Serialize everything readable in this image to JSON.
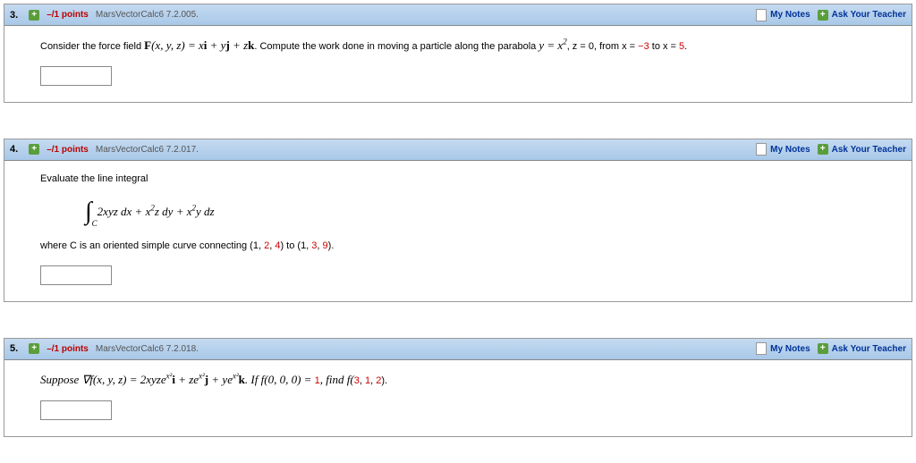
{
  "labels": {
    "my_notes": "My Notes",
    "ask_teacher": "Ask Your Teacher"
  },
  "questions": [
    {
      "number": "3.",
      "points": "–/1 points",
      "source": "MarsVectorCalc6 7.2.005.",
      "text_prefix": "Consider the force field ",
      "formula1": "F(x, y, z) = xi + yj + zk",
      "text_mid": ". Compute the work done in moving a particle along the parabola ",
      "formula2": "y = x²",
      "text_mid2": ", z = 0, from x = ",
      "val1": "−3",
      "text_mid3": " to x = ",
      "val2": "5",
      "text_end": "."
    },
    {
      "number": "4.",
      "points": "–/1 points",
      "source": "MarsVectorCalc6 7.2.017.",
      "line1": "Evaluate the line integral",
      "integral_expr": "2xyz dx + x²z dy + x²y dz",
      "line2_a": "where C is an oriented simple curve connecting (1, ",
      "v1": "2",
      "line2_b": ", ",
      "v2": "4",
      "line2_c": ") to (1, ",
      "v3": "3",
      "line2_d": ", ",
      "v4": "9",
      "line2_e": ")."
    },
    {
      "number": "5.",
      "points": "–/1 points",
      "source": "MarsVectorCalc6 7.2.018.",
      "text_a": "Suppose ∇f(x, y, z) = 2xyze",
      "text_b": "i + ze",
      "text_c": "j + ye",
      "text_d": "k. If f(0, 0, 0) = ",
      "v1": "1",
      "text_e": ", find f(",
      "v2": "3",
      "text_f": ", ",
      "v3": "1",
      "text_g": ", ",
      "v4": "2",
      "text_h": ")."
    }
  ]
}
